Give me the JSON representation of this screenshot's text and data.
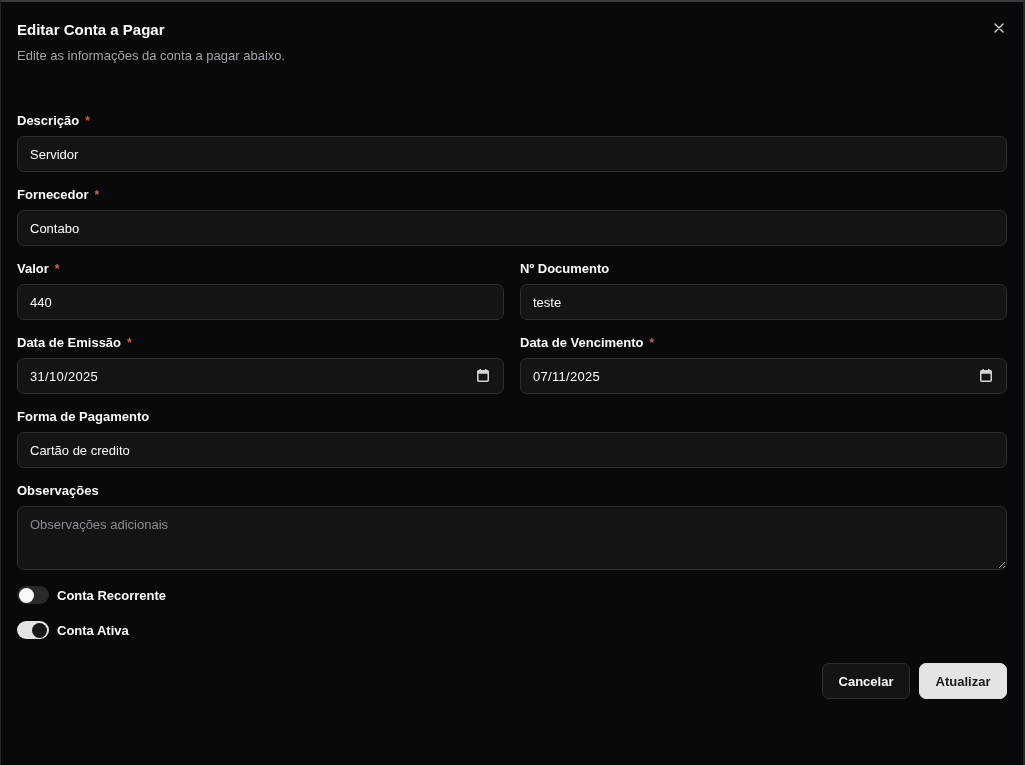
{
  "dialog": {
    "title": "Editar Conta a Pagar",
    "subtitle": "Edite as informações da conta a pagar abaixo."
  },
  "form": {
    "rows": [
      {
        "fields": [
          {
            "kind": "text",
            "label": "Descrição",
            "required_mark": "*",
            "value": "Servidor"
          }
        ]
      },
      {
        "fields": [
          {
            "kind": "text",
            "label": "Fornecedor",
            "required_mark": "*",
            "value": "Contabo"
          }
        ]
      },
      {
        "fields": [
          {
            "kind": "text",
            "label": "Valor",
            "required_mark": "*",
            "value": "440"
          },
          {
            "kind": "text",
            "label": "Nº Documento",
            "value": "teste"
          }
        ]
      },
      {
        "fields": [
          {
            "kind": "date",
            "label": "Data de Emissão",
            "required_mark": "*",
            "value": "31/10/2025"
          },
          {
            "kind": "date",
            "label": "Data de Vencimento",
            "required_mark": "*",
            "value": "07/11/2025"
          }
        ]
      },
      {
        "fields": [
          {
            "kind": "text",
            "label": "Forma de Pagamento",
            "value": "Cartão de credito"
          }
        ]
      },
      {
        "fields": [
          {
            "kind": "textarea",
            "label": "Observações",
            "placeholder": "Observações adicionais"
          }
        ]
      }
    ]
  },
  "toggles": [
    {
      "label": "Conta Recorrente",
      "on": false
    },
    {
      "label": "Conta Ativa",
      "on": true
    }
  ],
  "buttons": [
    {
      "label": "Cancelar",
      "kind": "outline"
    },
    {
      "label": "Atualizar",
      "kind": "primary"
    }
  ]
}
